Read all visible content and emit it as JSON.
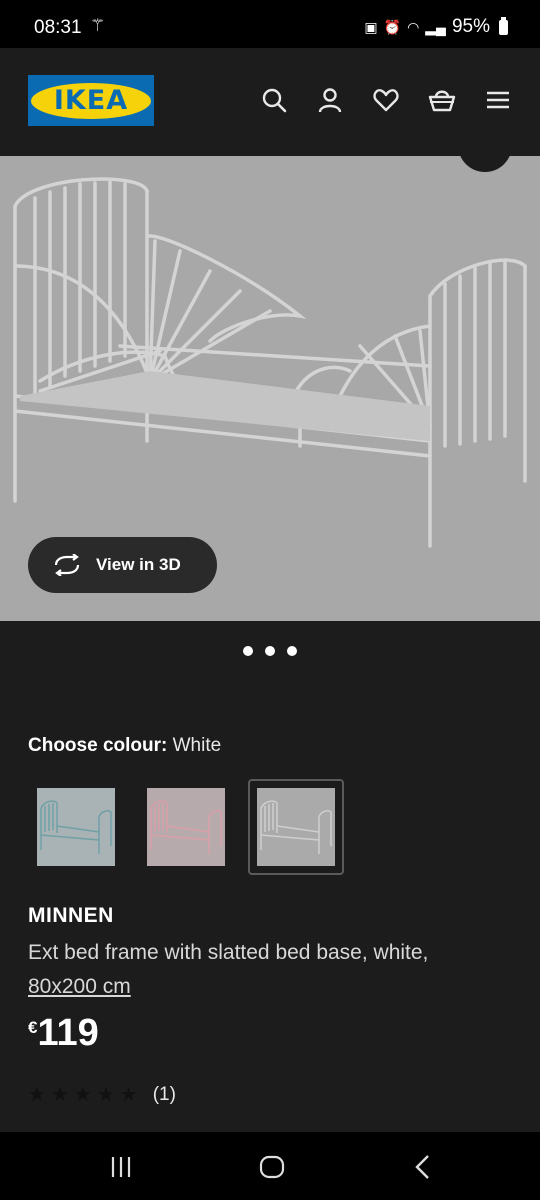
{
  "status_bar": {
    "time": "08:31",
    "battery": "95%",
    "icons": [
      "magic-wand-icon",
      "notification-icon",
      "alarm-icon",
      "wifi-icon",
      "signal-icon",
      "battery-icon"
    ]
  },
  "header": {
    "logo_text": "IKEA",
    "colors": {
      "logo_blue": "#0a6bb3",
      "logo_yellow": "#f6d20a",
      "background": "#1c1c1c"
    },
    "icons": [
      "search-icon",
      "account-icon",
      "heart-icon",
      "basket-icon",
      "menu-icon"
    ]
  },
  "gallery": {
    "view_3d_label": "View in 3D",
    "image_count": 3
  },
  "colour": {
    "label": "Choose colour:",
    "value": "White",
    "swatches": [
      "blue",
      "pink",
      "white"
    ],
    "selected": "white"
  },
  "product": {
    "name": "MINNEN",
    "description": "Ext bed frame with slatted bed base, white,",
    "size": "80x200 cm",
    "price_currency": "€",
    "price": "119",
    "rating_count": "(1)",
    "stars": 5
  }
}
